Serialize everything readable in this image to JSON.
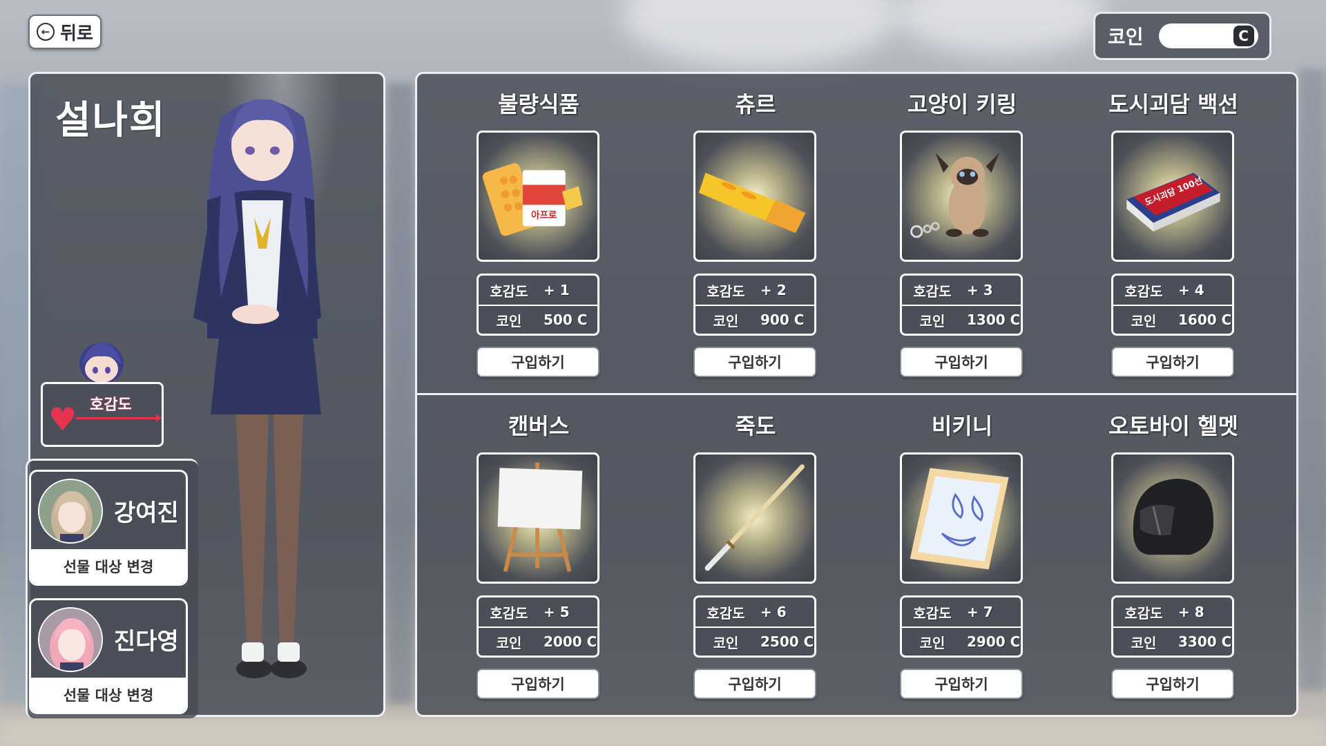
{
  "nav": {
    "back_label": "뒤로",
    "back_arrow": "←"
  },
  "wallet": {
    "label": "코인",
    "value": "",
    "currency_symbol": "C"
  },
  "character": {
    "name": "설나희",
    "affinity_label": "호감도",
    "affinity_icon": "heart-icon"
  },
  "gift_targets": [
    {
      "name": "강여진",
      "action": "선물 대상 변경"
    },
    {
      "name": "진다영",
      "action": "선물 대상 변경"
    }
  ],
  "shop": {
    "stat_label_affinity": "호감도",
    "stat_label_coin": "코인",
    "buy_label": "구입하기",
    "items": [
      {
        "name": "불량식품",
        "affinity": "+ 1",
        "price": "500 C"
      },
      {
        "name": "츄르",
        "affinity": "+ 2",
        "price": "900 C"
      },
      {
        "name": "고양이 키링",
        "affinity": "+ 3",
        "price": "1300 C"
      },
      {
        "name": "도시괴담 백선",
        "affinity": "+ 4",
        "price": "1600 C"
      },
      {
        "name": "캔버스",
        "affinity": "+ 5",
        "price": "2000 C"
      },
      {
        "name": "죽도",
        "affinity": "+ 6",
        "price": "2500 C"
      },
      {
        "name": "비키니",
        "affinity": "+ 7",
        "price": "2900 C"
      },
      {
        "name": "오토바이 헬멧",
        "affinity": "+ 8",
        "price": "3300 C"
      }
    ],
    "snack_pack_text": "아프로",
    "book_cover_text": "도시괴담 100선"
  },
  "colors": {
    "panel": "#464a54",
    "accent_heart": "#e8334f",
    "border": "#eef0f3"
  }
}
